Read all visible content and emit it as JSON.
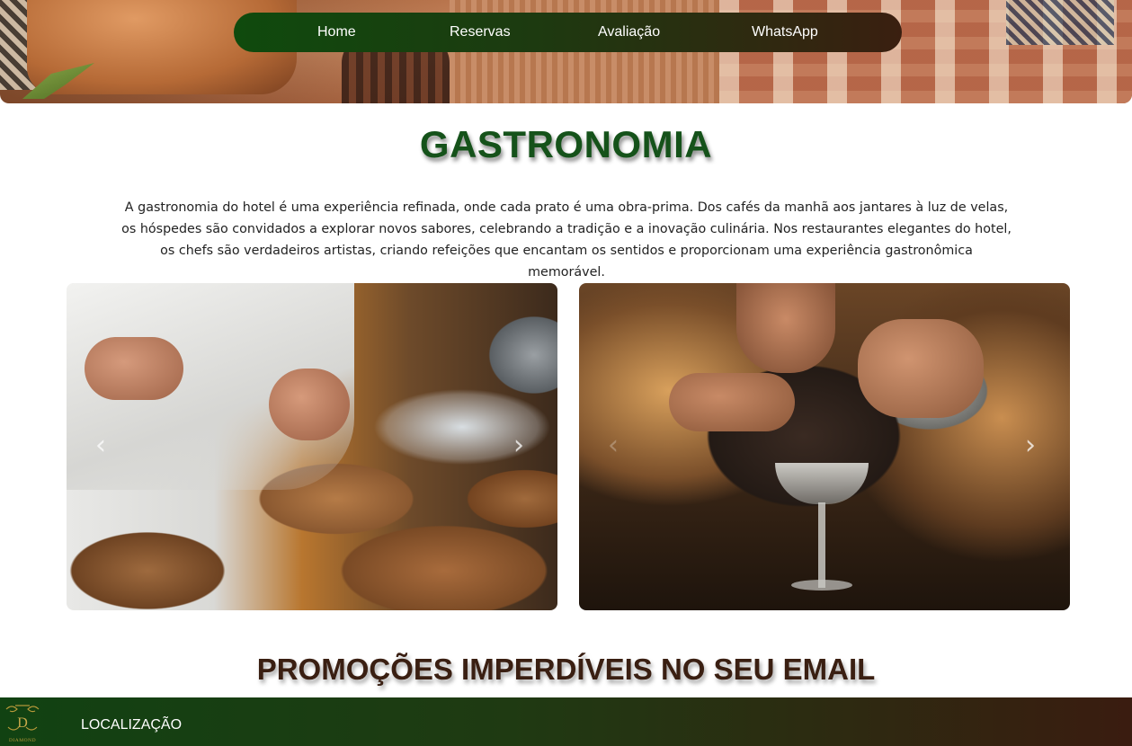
{
  "nav": {
    "items": [
      {
        "label": "Home"
      },
      {
        "label": "Reservas"
      },
      {
        "label": "Avaliação"
      },
      {
        "label": "WhatsApp"
      }
    ]
  },
  "section": {
    "title": "GASTRONOMIA",
    "intro": "A gastronomia do hotel é uma experiência refinada, onde cada prato é uma obra-prima. Dos cafés da manhã aos jantares à luz de velas, os hóspedes são convidados a explorar novos sabores, celebrando a tradição e a inovação culinária. Nos restaurantes elegantes do hotel, os chefs são verdadeiros artistas, criando refeições que encantam os sentidos e proporcionam uma experiência gastronômica memorável."
  },
  "carousel": {
    "prev_icon": "chevron-left-icon",
    "next_icon": "chevron-right-icon",
    "prev_glyph": "‹",
    "next_glyph": "›"
  },
  "promo": {
    "title": "PROMOÇÕES IMPERDÍVEIS NO SEU EMAIL"
  },
  "footer": {
    "logo_letter": "D",
    "logo_text": "DIAMOND",
    "location_label": "LOCALIZAÇÃO"
  },
  "colors": {
    "nav_start": "#0f4a0d",
    "nav_end": "#3a1f10",
    "title_green": "#15521a",
    "promo_brown": "#3a1f12"
  }
}
